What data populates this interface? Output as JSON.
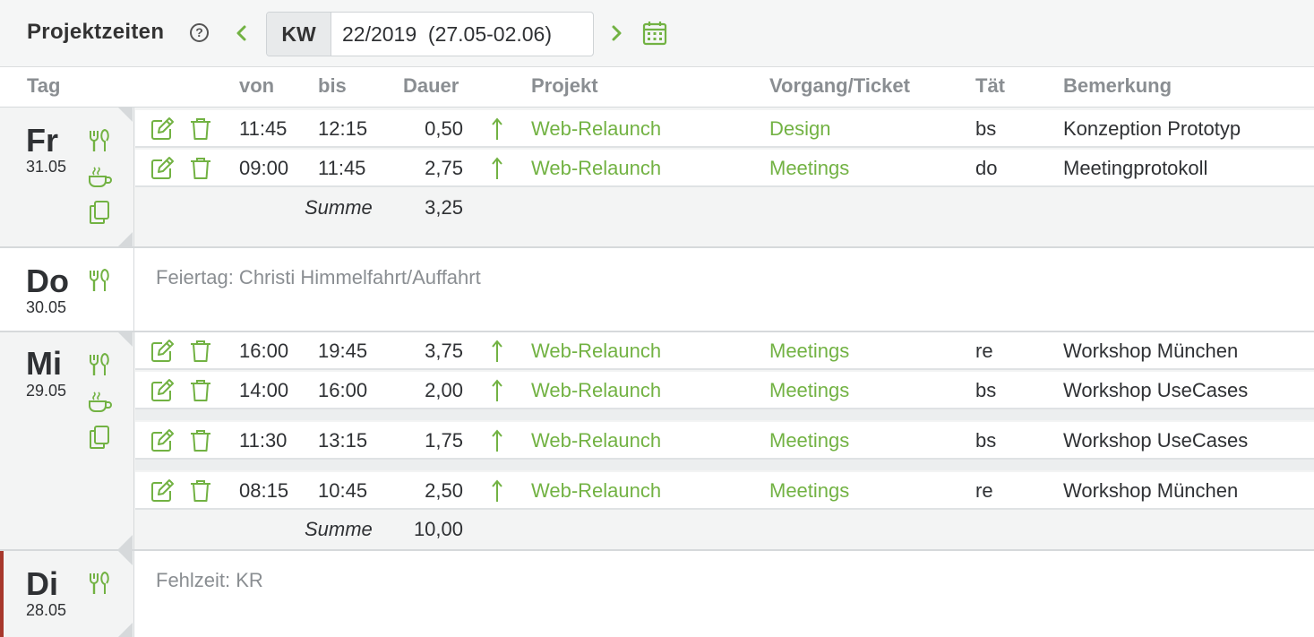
{
  "header": {
    "title": "Projektzeiten",
    "help_glyph": "?",
    "kw_label": "KW",
    "week_value": "22/2019  (27.05-02.06)",
    "prev_icon": "chevron-left-icon",
    "next_icon": "chevron-right-icon",
    "calendar_icon": "calendar-icon"
  },
  "columns": {
    "tag": "Tag",
    "von": "von",
    "bis": "bis",
    "dauer": "Dauer",
    "projekt": "Projekt",
    "ticket": "Vorgang/Ticket",
    "taet": "Tät",
    "bemerkung": "Bemerkung"
  },
  "days": [
    {
      "name": "Fr",
      "date": "31.05",
      "entries": [
        {
          "von": "11:45",
          "bis": "12:15",
          "dauer": "0,50",
          "projekt": "Web-Relaunch",
          "ticket": "Design",
          "taet": "bs",
          "bemerkung": "Konzeption Prototyp"
        },
        {
          "von": "09:00",
          "bis": "11:45",
          "dauer": "2,75",
          "projekt": "Web-Relaunch",
          "ticket": "Meetings",
          "taet": "do",
          "bemerkung": "Meetingprotokoll"
        }
      ],
      "sum_label": "Summe",
      "sum": "3,25"
    },
    {
      "name": "Do",
      "date": "30.05",
      "note": "Feiertag: Christi Himmelfahrt/Auffahrt"
    },
    {
      "name": "Mi",
      "date": "29.05",
      "entries": [
        {
          "von": "16:00",
          "bis": "19:45",
          "dauer": "3,75",
          "projekt": "Web-Relaunch",
          "ticket": "Meetings",
          "taet": "re",
          "bemerkung": "Workshop München"
        },
        {
          "von": "14:00",
          "bis": "16:00",
          "dauer": "2,00",
          "projekt": "Web-Relaunch",
          "ticket": "Meetings",
          "taet": "bs",
          "bemerkung": "Workshop UseCases"
        },
        {
          "von": "11:30",
          "bis": "13:15",
          "dauer": "1,75",
          "projekt": "Web-Relaunch",
          "ticket": "Meetings",
          "taet": "bs",
          "bemerkung": "Workshop UseCases"
        },
        {
          "von": "08:15",
          "bis": "10:45",
          "dauer": "2,50",
          "projekt": "Web-Relaunch",
          "ticket": "Meetings",
          "taet": "re",
          "bemerkung": "Workshop München"
        }
      ],
      "sum_label": "Summe",
      "sum": "10,00"
    },
    {
      "name": "Di",
      "date": "28.05",
      "note": "Fehlzeit: KR"
    }
  ],
  "colors": {
    "accent_green": "#72b243",
    "absence_red": "#a7382c",
    "muted_text": "#8a8e92"
  }
}
